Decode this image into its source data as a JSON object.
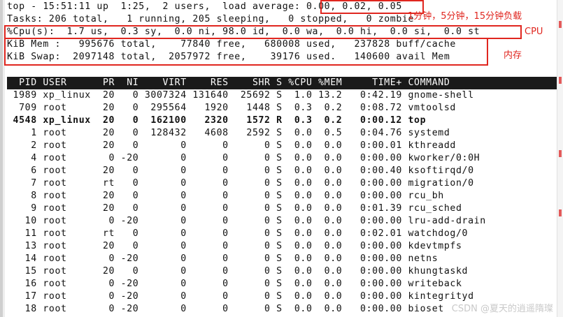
{
  "summary": {
    "line1": "top - 15:51:11 up  1:25,  2 users,  load average: 0.00, 0.02, 0.05",
    "line2": "Tasks: 206 total,   1 running, 205 sleeping,   0 stopped,   0 zombie",
    "line3": "%Cpu(s):  1.7 us,  0.3 sy,  0.0 ni, 98.0 id,  0.0 wa,  0.0 hi,  0.0 si,  0.0 st",
    "line4": "KiB Mem :   995676 total,    77840 free,   680008 used,   237828 buff/cache",
    "line5": "KiB Swap:  2097148 total,  2057972 free,    39176 used.   140600 avail Mem"
  },
  "table": {
    "header": "  PID USER      PR  NI    VIRT    RES    SHR S %CPU %MEM     TIME+ COMMAND",
    "rows": [
      " 1989 xp_linux  20   0 3007324 131640  25692 S  1.0 13.2   0:42.19 gnome-shell",
      "  709 root      20   0  295564   1920   1448 S  0.3  0.2   0:08.72 vmtoolsd",
      " 4548 xp_linux  20   0  162100   2320   1572 R  0.3  0.2   0:00.12 top",
      "    1 root      20   0  128432   4608   2592 S  0.0  0.5   0:04.76 systemd",
      "    2 root      20   0       0      0      0 S  0.0  0.0   0:00.01 kthreadd",
      "    4 root       0 -20       0      0      0 S  0.0  0.0   0:00.00 kworker/0:0H",
      "    6 root      20   0       0      0      0 S  0.0  0.0   0:00.40 ksoftirqd/0",
      "    7 root      rt   0       0      0      0 S  0.0  0.0   0:00.00 migration/0",
      "    8 root      20   0       0      0      0 S  0.0  0.0   0:00.00 rcu_bh",
      "    9 root      20   0       0      0      0 S  0.0  0.0   0:01.39 rcu_sched",
      "   10 root       0 -20       0      0      0 S  0.0  0.0   0:00.00 lru-add-drain",
      "   11 root      rt   0       0      0      0 S  0.0  0.0   0:02.01 watchdog/0",
      "   13 root      20   0       0      0      0 S  0.0  0.0   0:00.00 kdevtmpfs",
      "   14 root       0 -20       0      0      0 S  0.0  0.0   0:00.00 netns",
      "   15 root      20   0       0      0      0 S  0.0  0.0   0:00.00 khungtaskd",
      "   16 root       0 -20       0      0      0 S  0.0  0.0   0:00.00 writeback",
      "   17 root       0 -20       0      0      0 S  0.0  0.0   0:00.00 kintegrityd",
      "   18 root       0 -20       0      0      0 S  0.0  0.0   0:00.00 bioset"
    ]
  },
  "annotations": {
    "load_label": "1分钟，5分钟，15分钟负载",
    "cpu_label": "CPU",
    "mem_label": "内存",
    "color": "#e0261f"
  },
  "watermark": "CSDN @夏天的逍遥隋璨"
}
